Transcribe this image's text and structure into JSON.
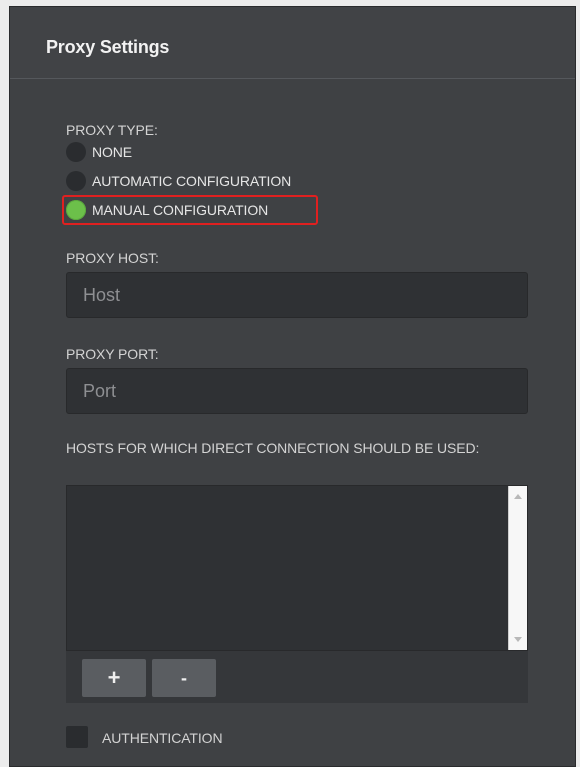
{
  "panel": {
    "title": "Proxy Settings"
  },
  "proxy_type": {
    "label": "PROXY TYPE:",
    "options": [
      {
        "label": "NONE",
        "selected": false
      },
      {
        "label": "AUTOMATIC CONFIGURATION",
        "selected": false
      },
      {
        "label": "MANUAL CONFIGURATION",
        "selected": true
      }
    ]
  },
  "proxy_host": {
    "label": "PROXY HOST:",
    "placeholder": "Host",
    "value": ""
  },
  "proxy_port": {
    "label": "PROXY PORT:",
    "placeholder": "Port",
    "value": ""
  },
  "direct_hosts": {
    "label": "HOSTS FOR WHICH DIRECT CONNECTION SHOULD BE USED:",
    "value": "",
    "add_label": "+",
    "remove_label": "-"
  },
  "authentication": {
    "label": "AUTHENTICATION",
    "checked": false
  },
  "colors": {
    "panel_bg": "#3f4144",
    "selected_radio": "#6cc04a",
    "highlight_border": "#e02020"
  }
}
